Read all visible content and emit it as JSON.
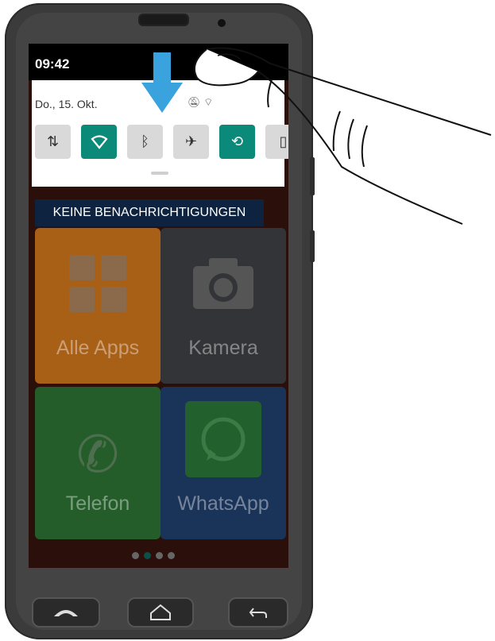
{
  "status_bar": {
    "time": "09:42"
  },
  "notification_shade": {
    "date": "Do., 15. Okt.",
    "status_icons": [
      "bell-off-icon",
      "wifi-icon"
    ],
    "quick_tiles": [
      {
        "name": "data",
        "icon": "data-arrows-icon",
        "active": false
      },
      {
        "name": "wifi",
        "icon": "wifi-icon",
        "active": true
      },
      {
        "name": "bluetooth",
        "icon": "bluetooth-icon",
        "active": false
      },
      {
        "name": "airplane",
        "icon": "airplane-icon",
        "active": false
      },
      {
        "name": "auto-rotate",
        "icon": "rotate-icon",
        "active": true
      },
      {
        "name": "flashlight",
        "icon": "flashlight-icon",
        "active": false
      }
    ]
  },
  "notifications": {
    "label": "KEINE BENACHRICHTIGUNGEN"
  },
  "apps": [
    {
      "label": "Alle Apps",
      "color": "#d17a1e"
    },
    {
      "label": "Kamera",
      "color": "#3f3f3f"
    },
    {
      "label": "Telefon",
      "color": "#2d8a3a"
    },
    {
      "label": "WhatsApp",
      "color": "#1e3f73"
    }
  ],
  "page_dots": {
    "count": 4,
    "active_index": 1
  },
  "colors": {
    "accent": "#0b8a7a",
    "arrow": "#3aa3dd"
  }
}
